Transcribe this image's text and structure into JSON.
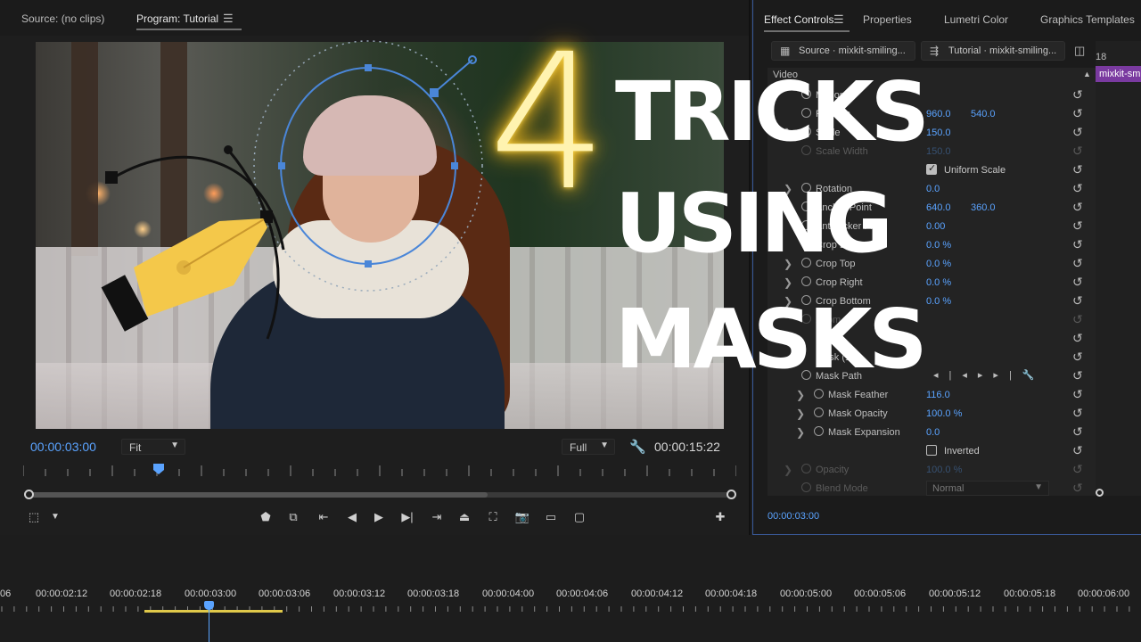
{
  "monitor": {
    "source_tab": "Source: (no clips)",
    "program_tab": "Program: Tutorial",
    "current_time": "00:00:03:00",
    "duration": "00:00:15:22",
    "zoom_select": "Fit",
    "resolution_select": "Full",
    "playhead_fraction": 0.19
  },
  "thumbnail": {
    "number": "4",
    "line1": "TRICKS",
    "line2": "USING",
    "line3": "MASKS",
    "glow_color": "#ffd84a"
  },
  "effect_panel": {
    "tabs": [
      "Effect Controls",
      "Properties",
      "Lumetri Color",
      "Graphics Templates"
    ],
    "source_button": "Source · mixkit-smiling...",
    "clip_button": "Tutorial · mixkit-smiling...",
    "clip_label": "mixkit-smi",
    "ruler_number": "18",
    "section": "Video",
    "rows": [
      {
        "label": "Motion",
        "v1": "",
        "v2": ""
      },
      {
        "label": "Position",
        "v1": "960.0",
        "v2": "540.0"
      },
      {
        "label": "Scale",
        "v1": "150.0",
        "v2": ""
      },
      {
        "label": "Scale Width",
        "v1": "150.0",
        "v2": ""
      },
      {
        "label": "Uniform Scale",
        "v1": "",
        "v2": ""
      },
      {
        "label": "Rotation",
        "v1": "0.0",
        "v2": ""
      },
      {
        "label": "Anchor Point",
        "v1": "640.0",
        "v2": "360.0"
      },
      {
        "label": "Anti-flicker Filter",
        "v1": "0.00",
        "v2": ""
      },
      {
        "label": "Crop Left",
        "v1": "0.0 %",
        "v2": ""
      },
      {
        "label": "Crop Top",
        "v1": "0.0 %",
        "v2": ""
      },
      {
        "label": "Crop Right",
        "v1": "0.0 %",
        "v2": ""
      },
      {
        "label": "Crop Bottom",
        "v1": "0.0 %",
        "v2": ""
      },
      {
        "label": "Zoom",
        "v1": "",
        "v2": ""
      },
      {
        "label": "",
        "v1": "",
        "v2": ""
      },
      {
        "label": "Mask (1)",
        "v1": "",
        "v2": ""
      },
      {
        "label": "Mask Path",
        "v1": "",
        "v2": ""
      },
      {
        "label": "Mask Feather",
        "v1": "116.0",
        "v2": ""
      },
      {
        "label": "Mask Opacity",
        "v1": "100.0 %",
        "v2": ""
      },
      {
        "label": "Mask Expansion",
        "v1": "0.0",
        "v2": ""
      },
      {
        "label": "Inverted",
        "v1": "",
        "v2": ""
      },
      {
        "label": "Opacity",
        "v1": "100.0 %",
        "v2": ""
      },
      {
        "label": "Blend Mode",
        "v1": "Normal",
        "v2": ""
      }
    ],
    "uniform_scale_checked": true,
    "inverted_checked": false,
    "footer_time": "00:00:03:00"
  },
  "timeline": {
    "labels": [
      "06",
      "00:00:02:12",
      "00:00:02:18",
      "00:00:03:00",
      "00:00:03:06",
      "00:00:03:12",
      "00:00:03:18",
      "00:00:04:00",
      "00:00:04:06",
      "00:00:04:12",
      "00:00:04:18",
      "00:00:05:00",
      "00:00:05:06",
      "00:00:05:12",
      "00:00:05:18",
      "00:00:06:00"
    ]
  }
}
